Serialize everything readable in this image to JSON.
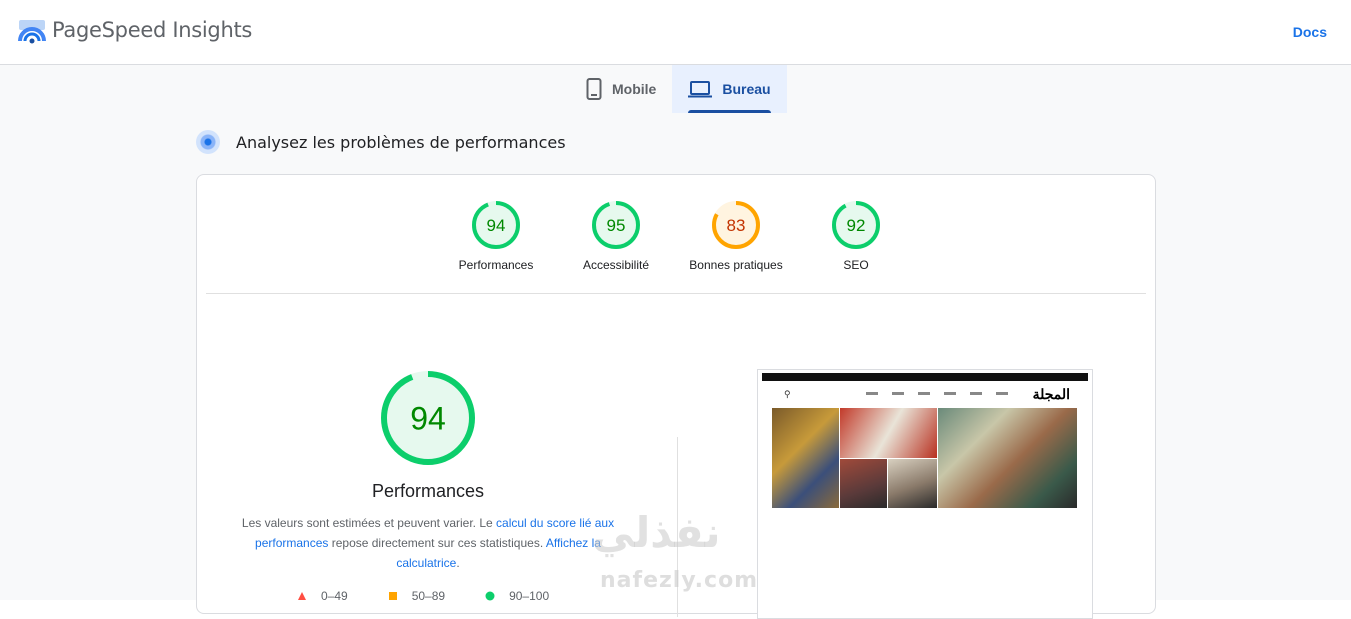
{
  "header": {
    "app_title": "PageSpeed Insights",
    "docs_label": "Docs"
  },
  "tabs": [
    {
      "label": "Mobile",
      "icon": "phone-icon",
      "active": false
    },
    {
      "label": "Bureau",
      "icon": "laptop-icon",
      "active": true
    }
  ],
  "section": {
    "title": "Analysez les problèmes de performances"
  },
  "scores": [
    {
      "value": "94",
      "label": "Performances",
      "color": "#0cce6b",
      "text_color": "#008800",
      "bg": "#e6f9ee",
      "fraction": 0.94
    },
    {
      "value": "95",
      "label": "Accessibilité",
      "color": "#0cce6b",
      "text_color": "#008800",
      "bg": "#e6f9ee",
      "fraction": 0.95
    },
    {
      "value": "83",
      "label": "Bonnes pratiques",
      "color": "#ffa400",
      "text_color": "#c33300",
      "bg": "#fff4e0",
      "fraction": 0.83
    },
    {
      "value": "92",
      "label": "SEO",
      "color": "#0cce6b",
      "text_color": "#008800",
      "bg": "#e6f9ee",
      "fraction": 0.92
    }
  ],
  "main_score": {
    "value": "94",
    "label": "Performances",
    "fraction": 0.94
  },
  "description": {
    "text1": "Les valeurs sont estimées et peuvent varier. Le ",
    "link1": "calcul du score lié aux performances",
    "text2": " repose directement sur ces statistiques. ",
    "link2": "Affichez la calculatrice",
    "text3": "."
  },
  "legend": [
    {
      "range": "0–49",
      "color": "#ff4e42",
      "shape": "triangle"
    },
    {
      "range": "50–89",
      "color": "#ffa400",
      "shape": "square"
    },
    {
      "range": "90–100",
      "color": "#0cce6b",
      "shape": "circle"
    }
  ],
  "preview": {
    "site_logo": "المجلة"
  },
  "watermark": {
    "arabic": "نفذلي",
    "latin": "nafezly.com"
  }
}
